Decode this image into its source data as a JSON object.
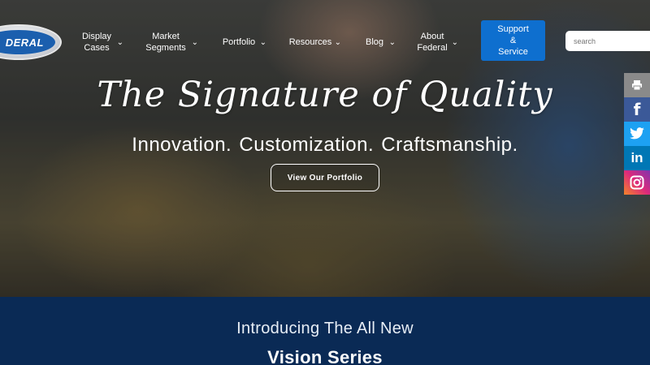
{
  "brand": {
    "logo_text": "DERAL"
  },
  "nav": {
    "items": [
      {
        "label_line1": "Display",
        "label_line2": "Cases"
      },
      {
        "label_line1": "Market",
        "label_line2": "Segments"
      },
      {
        "label_line1": "Portfolio",
        "label_line2": ""
      },
      {
        "label_line1": "Resources",
        "label_line2": ""
      },
      {
        "label_line1": "Blog",
        "label_line2": ""
      },
      {
        "label_line1": "About",
        "label_line2": "Federal"
      }
    ],
    "support_line1": "Support",
    "support_line2": "&",
    "support_line3": "Service",
    "search_placeholder": "search"
  },
  "hero": {
    "headline": "The Signature of Quality",
    "subline": "Innovation.  Customization.  Craftsmanship.",
    "cta_label": "View Our Portfolio"
  },
  "social": {
    "icons": [
      "print-icon",
      "facebook-icon",
      "twitter-icon",
      "linkedin-icon",
      "instagram-icon"
    ],
    "facebook_glyph": "f",
    "linkedin_glyph": "in"
  },
  "band": {
    "intro": "Introducing The All New",
    "title": "Vision Series"
  },
  "colors": {
    "navy": "#0a2a55",
    "support_blue": "#0e6fcf",
    "facebook": "#3b5998",
    "twitter": "#1da1f2",
    "linkedin": "#0077b5"
  }
}
